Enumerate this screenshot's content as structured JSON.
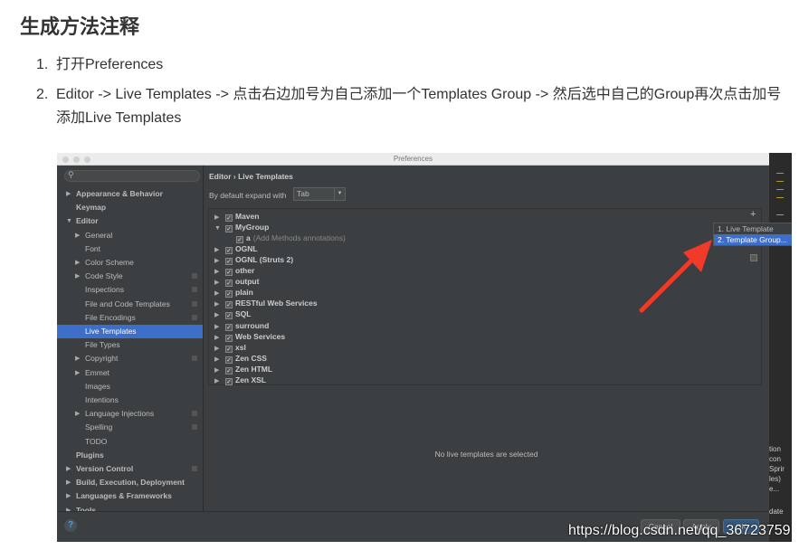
{
  "article": {
    "title": "生成方法注释",
    "steps": [
      {
        "num": "1.",
        "text": "打开Preferences"
      },
      {
        "num": "2.",
        "text": "Editor -> Live Templates -> 点击右边加号为自己添加一个Templates Group -> 然后选中自己的Group再次点击加号添加Live Templates"
      }
    ]
  },
  "dialog": {
    "title": "Preferences",
    "breadcrumb": "Editor › Live Templates",
    "expand_label": "By default expand with",
    "expand_value": "Tab",
    "empty_text": "No live templates are selected",
    "buttons": {
      "cancel": "Cancel",
      "apply": "Apply",
      "ok": "OK"
    },
    "help": "?"
  },
  "sidebar": [
    {
      "label": "Appearance & Behavior",
      "level": 0,
      "arrow": "right",
      "bold": true
    },
    {
      "label": "Keymap",
      "level": 0,
      "bold": true
    },
    {
      "label": "Editor",
      "level": 0,
      "arrow": "down",
      "bold": true
    },
    {
      "label": "General",
      "level": 1,
      "arrow": "right"
    },
    {
      "label": "Font",
      "level": 1
    },
    {
      "label": "Color Scheme",
      "level": 1,
      "arrow": "right"
    },
    {
      "label": "Code Style",
      "level": 1,
      "arrow": "right",
      "copy": true
    },
    {
      "label": "Inspections",
      "level": 1,
      "copy": true
    },
    {
      "label": "File and Code Templates",
      "level": 1,
      "copy": true
    },
    {
      "label": "File Encodings",
      "level": 1,
      "copy": true
    },
    {
      "label": "Live Templates",
      "level": 1,
      "selected": true
    },
    {
      "label": "File Types",
      "level": 1
    },
    {
      "label": "Copyright",
      "level": 1,
      "arrow": "right",
      "copy": true
    },
    {
      "label": "Emmet",
      "level": 1,
      "arrow": "right"
    },
    {
      "label": "Images",
      "level": 1
    },
    {
      "label": "Intentions",
      "level": 1
    },
    {
      "label": "Language Injections",
      "level": 1,
      "arrow": "right",
      "copy": true
    },
    {
      "label": "Spelling",
      "level": 1,
      "copy": true
    },
    {
      "label": "TODO",
      "level": 1
    },
    {
      "label": "Plugins",
      "level": 0,
      "bold": true
    },
    {
      "label": "Version Control",
      "level": 0,
      "arrow": "right",
      "bold": true,
      "copy": true
    },
    {
      "label": "Build, Execution, Deployment",
      "level": 0,
      "arrow": "right",
      "bold": true
    },
    {
      "label": "Languages & Frameworks",
      "level": 0,
      "arrow": "right",
      "bold": true
    },
    {
      "label": "Tools",
      "level": 0,
      "arrow": "right",
      "bold": true
    }
  ],
  "templates": [
    {
      "label": "Maven",
      "arrow": "right"
    },
    {
      "label": "MyGroup",
      "arrow": "down"
    },
    {
      "label": "a",
      "desc": "(Add Methods annotations)",
      "child": true
    },
    {
      "label": "OGNL",
      "arrow": "right"
    },
    {
      "label": "OGNL (Struts 2)",
      "arrow": "right"
    },
    {
      "label": "other",
      "arrow": "right"
    },
    {
      "label": "output",
      "arrow": "right"
    },
    {
      "label": "plain",
      "arrow": "right"
    },
    {
      "label": "RESTful Web Services",
      "arrow": "right"
    },
    {
      "label": "SQL",
      "arrow": "right"
    },
    {
      "label": "surround",
      "arrow": "right"
    },
    {
      "label": "Web Services",
      "arrow": "right"
    },
    {
      "label": "xsl",
      "arrow": "right"
    },
    {
      "label": "Zen CSS",
      "arrow": "right"
    },
    {
      "label": "Zen HTML",
      "arrow": "right"
    },
    {
      "label": "Zen XSL",
      "arrow": "right"
    }
  ],
  "add_menu": {
    "plus": "+",
    "items": [
      "1. Live Template",
      "2. Template Group..."
    ],
    "selected": 1
  },
  "ide_strip_text": [
    "tion",
    "con",
    "Sprir",
    "les)",
    "e...",
    "date"
  ],
  "watermark": "https://blog.csdn.net/qq_36723759",
  "colors": {
    "selection": "#3d6ec9",
    "panel": "#3c3f41",
    "arrow": "#f23a2a"
  }
}
